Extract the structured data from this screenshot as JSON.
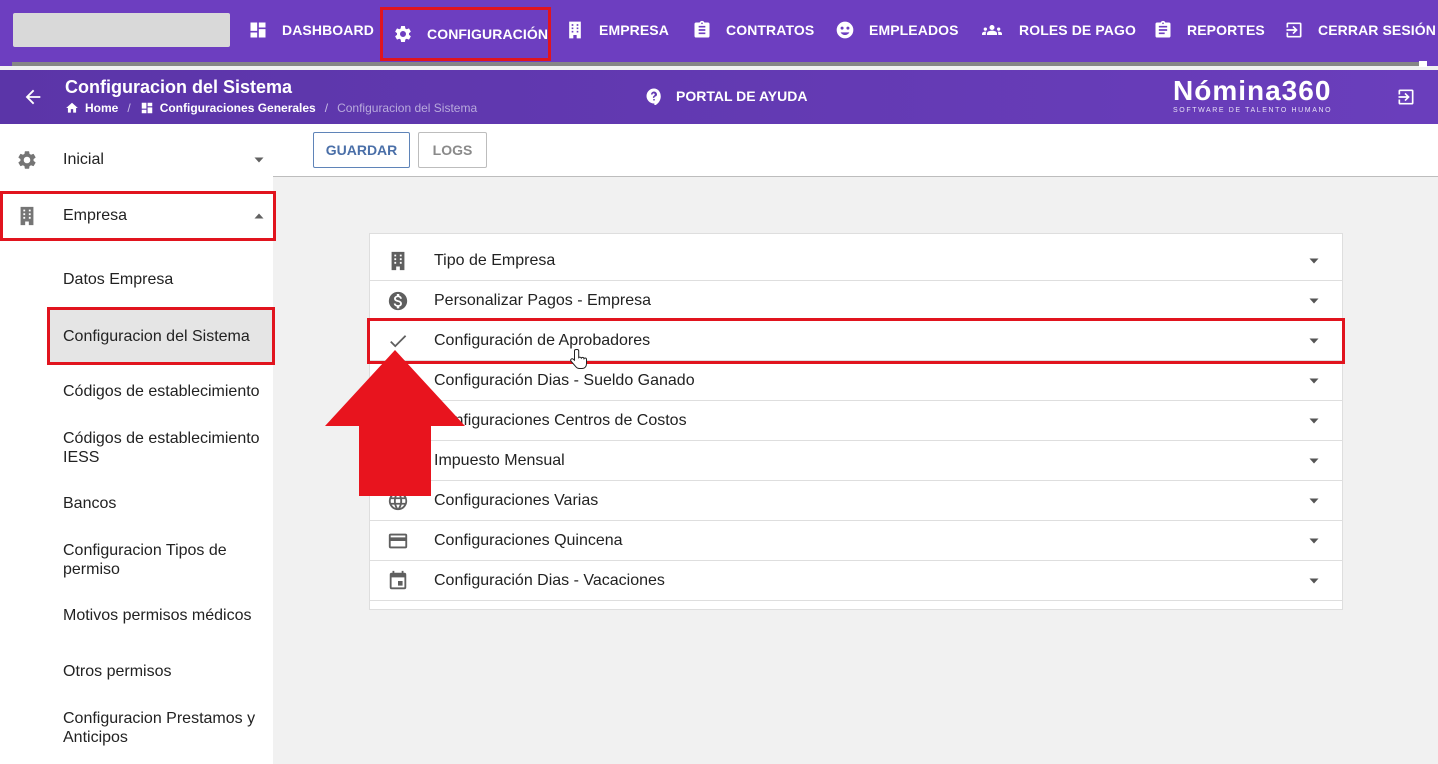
{
  "topnav": {
    "items": [
      {
        "label": "DASHBOARD",
        "icon": "dashboard-icon"
      },
      {
        "label": "CONFIGURACIÓN",
        "icon": "gear-icon",
        "highlighted": true
      },
      {
        "label": "EMPRESA",
        "icon": "building-icon"
      },
      {
        "label": "CONTRATOS",
        "icon": "clipboard-icon"
      },
      {
        "label": "EMPLEADOS",
        "icon": "employees-icon"
      },
      {
        "label": "ROLES DE PAGO",
        "icon": "group-icon"
      },
      {
        "label": "REPORTES",
        "icon": "report-icon"
      },
      {
        "label": "CERRAR SESIÓN",
        "icon": "logout-icon"
      }
    ]
  },
  "header": {
    "title": "Configuracion del Sistema",
    "breadcrumb": [
      "Home",
      "Configuraciones Generales",
      "Configuracion del Sistema"
    ],
    "help_label": "PORTAL DE AYUDA",
    "brand_name": "Nómina360",
    "brand_tagline": "SOFTWARE DE TALENTO HUMANO"
  },
  "sidebar": {
    "sections": [
      {
        "label": "Inicial",
        "icon": "gear-icon",
        "expanded": false
      },
      {
        "label": "Empresa",
        "icon": "building-icon",
        "expanded": true,
        "highlighted": true
      }
    ],
    "subitems": [
      {
        "label": "Datos Empresa"
      },
      {
        "label": "Configuracion del Sistema",
        "selected": true
      },
      {
        "label": "Códigos de establecimiento"
      },
      {
        "label": "Códigos de establecimiento IESS"
      },
      {
        "label": "Bancos"
      },
      {
        "label": "Configuracion Tipos de permiso"
      },
      {
        "label": "Motivos permisos médicos"
      },
      {
        "label": "Otros permisos"
      },
      {
        "label": "Configuracion Prestamos y Anticipos"
      }
    ]
  },
  "toolbar": {
    "save_label": "GUARDAR",
    "logs_label": "LOGS"
  },
  "panel": {
    "rows": [
      {
        "label": "Tipo de Empresa",
        "icon": "building-icon"
      },
      {
        "label": "Personalizar Pagos - Empresa",
        "icon": "dollar-icon"
      },
      {
        "label": "Configuración de Aprobadores",
        "icon": "check-icon",
        "highlighted": true
      },
      {
        "label": "Configuración Dias - Sueldo Ganado",
        "icon": "calendar-icon"
      },
      {
        "label": "Configuraciones Centros de Costos",
        "icon": "cost-center-icon"
      },
      {
        "label": "Impuesto Mensual",
        "icon": "tax-icon"
      },
      {
        "label": "Configuraciones Varias",
        "icon": "globe-icon"
      },
      {
        "label": "Configuraciones Quincena",
        "icon": "card-icon"
      },
      {
        "label": "Configuración Dias - Vacaciones",
        "icon": "event-icon"
      }
    ]
  },
  "colors": {
    "nav_bg": "#6d3ec0",
    "highlight": "#e1141e",
    "primary_button": "#4a6fa8"
  }
}
